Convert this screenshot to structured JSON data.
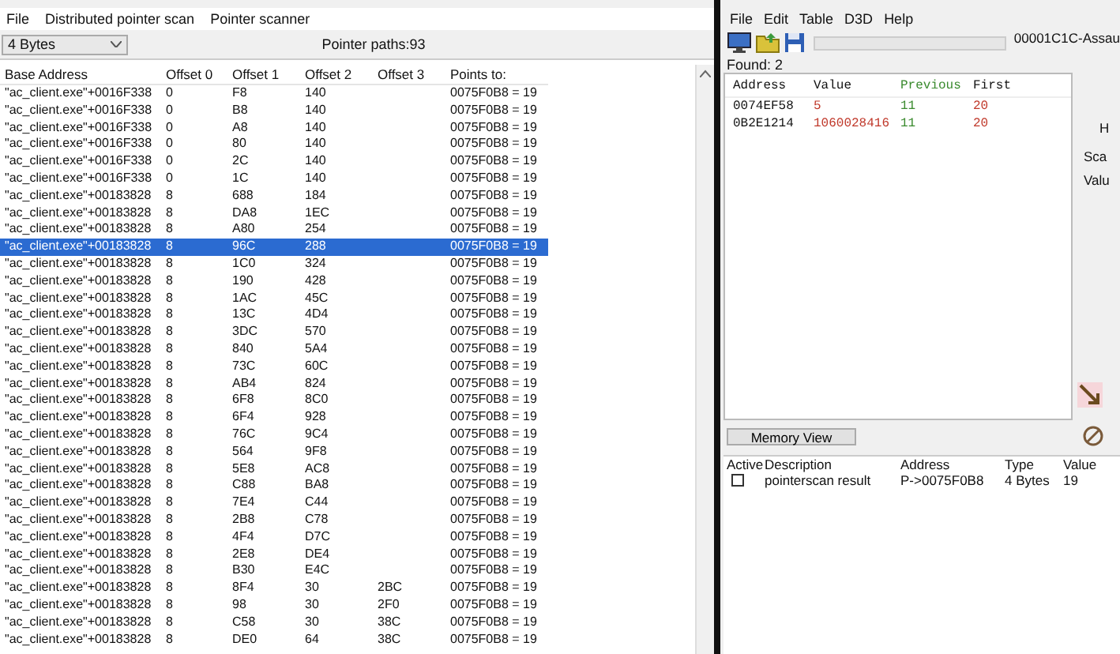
{
  "pointer_scanner": {
    "menu": [
      "File",
      "Distributed pointer scan",
      "Pointer scanner"
    ],
    "type_select": {
      "value": "4 Bytes"
    },
    "pointer_paths": "Pointer paths:93",
    "table": {
      "columns": [
        "Base Address",
        "Offset 0",
        "Offset 1",
        "Offset 2",
        "Offset 3",
        "Points to:"
      ],
      "rows": [
        {
          "cells": [
            "\"ac_client.exe\"+0016F338",
            "0",
            "F8",
            "140",
            "",
            "0075F0B8 = 19"
          ],
          "selected": false
        },
        {
          "cells": [
            "\"ac_client.exe\"+0016F338",
            "0",
            "B8",
            "140",
            "",
            "0075F0B8 = 19"
          ],
          "selected": false
        },
        {
          "cells": [
            "\"ac_client.exe\"+0016F338",
            "0",
            "A8",
            "140",
            "",
            "0075F0B8 = 19"
          ],
          "selected": false
        },
        {
          "cells": [
            "\"ac_client.exe\"+0016F338",
            "0",
            "80",
            "140",
            "",
            "0075F0B8 = 19"
          ],
          "selected": false
        },
        {
          "cells": [
            "\"ac_client.exe\"+0016F338",
            "0",
            "2C",
            "140",
            "",
            "0075F0B8 = 19"
          ],
          "selected": false
        },
        {
          "cells": [
            "\"ac_client.exe\"+0016F338",
            "0",
            "1C",
            "140",
            "",
            "0075F0B8 = 19"
          ],
          "selected": false
        },
        {
          "cells": [
            "\"ac_client.exe\"+00183828",
            "8",
            "688",
            "184",
            "",
            "0075F0B8 = 19"
          ],
          "selected": false
        },
        {
          "cells": [
            "\"ac_client.exe\"+00183828",
            "8",
            "DA8",
            "1EC",
            "",
            "0075F0B8 = 19"
          ],
          "selected": false
        },
        {
          "cells": [
            "\"ac_client.exe\"+00183828",
            "8",
            "A80",
            "254",
            "",
            "0075F0B8 = 19"
          ],
          "selected": false
        },
        {
          "cells": [
            "\"ac_client.exe\"+00183828",
            "8",
            "96C",
            "288",
            "",
            "0075F0B8 = 19"
          ],
          "selected": true
        },
        {
          "cells": [
            "\"ac_client.exe\"+00183828",
            "8",
            "1C0",
            "324",
            "",
            "0075F0B8 = 19"
          ],
          "selected": false
        },
        {
          "cells": [
            "\"ac_client.exe\"+00183828",
            "8",
            "190",
            "428",
            "",
            "0075F0B8 = 19"
          ],
          "selected": false
        },
        {
          "cells": [
            "\"ac_client.exe\"+00183828",
            "8",
            "1AC",
            "45C",
            "",
            "0075F0B8 = 19"
          ],
          "selected": false
        },
        {
          "cells": [
            "\"ac_client.exe\"+00183828",
            "8",
            "13C",
            "4D4",
            "",
            "0075F0B8 = 19"
          ],
          "selected": false
        },
        {
          "cells": [
            "\"ac_client.exe\"+00183828",
            "8",
            "3DC",
            "570",
            "",
            "0075F0B8 = 19"
          ],
          "selected": false
        },
        {
          "cells": [
            "\"ac_client.exe\"+00183828",
            "8",
            "840",
            "5A4",
            "",
            "0075F0B8 = 19"
          ],
          "selected": false
        },
        {
          "cells": [
            "\"ac_client.exe\"+00183828",
            "8",
            "73C",
            "60C",
            "",
            "0075F0B8 = 19"
          ],
          "selected": false
        },
        {
          "cells": [
            "\"ac_client.exe\"+00183828",
            "8",
            "AB4",
            "824",
            "",
            "0075F0B8 = 19"
          ],
          "selected": false
        },
        {
          "cells": [
            "\"ac_client.exe\"+00183828",
            "8",
            "6F8",
            "8C0",
            "",
            "0075F0B8 = 19"
          ],
          "selected": false
        },
        {
          "cells": [
            "\"ac_client.exe\"+00183828",
            "8",
            "6F4",
            "928",
            "",
            "0075F0B8 = 19"
          ],
          "selected": false
        },
        {
          "cells": [
            "\"ac_client.exe\"+00183828",
            "8",
            "76C",
            "9C4",
            "",
            "0075F0B8 = 19"
          ],
          "selected": false
        },
        {
          "cells": [
            "\"ac_client.exe\"+00183828",
            "8",
            "564",
            "9F8",
            "",
            "0075F0B8 = 19"
          ],
          "selected": false
        },
        {
          "cells": [
            "\"ac_client.exe\"+00183828",
            "8",
            "5E8",
            "AC8",
            "",
            "0075F0B8 = 19"
          ],
          "selected": false
        },
        {
          "cells": [
            "\"ac_client.exe\"+00183828",
            "8",
            "C88",
            "BA8",
            "",
            "0075F0B8 = 19"
          ],
          "selected": false
        },
        {
          "cells": [
            "\"ac_client.exe\"+00183828",
            "8",
            "7E4",
            "C44",
            "",
            "0075F0B8 = 19"
          ],
          "selected": false
        },
        {
          "cells": [
            "\"ac_client.exe\"+00183828",
            "8",
            "2B8",
            "C78",
            "",
            "0075F0B8 = 19"
          ],
          "selected": false
        },
        {
          "cells": [
            "\"ac_client.exe\"+00183828",
            "8",
            "4F4",
            "D7C",
            "",
            "0075F0B8 = 19"
          ],
          "selected": false
        },
        {
          "cells": [
            "\"ac_client.exe\"+00183828",
            "8",
            "2E8",
            "DE4",
            "",
            "0075F0B8 = 19"
          ],
          "selected": false
        },
        {
          "cells": [
            "\"ac_client.exe\"+00183828",
            "8",
            "B30",
            "E4C",
            "",
            "0075F0B8 = 19"
          ],
          "selected": false
        },
        {
          "cells": [
            "\"ac_client.exe\"+00183828",
            "8",
            "8F4",
            "30",
            "2BC",
            "0075F0B8 = 19"
          ],
          "selected": false
        },
        {
          "cells": [
            "\"ac_client.exe\"+00183828",
            "8",
            "98",
            "30",
            "2F0",
            "0075F0B8 = 19"
          ],
          "selected": false
        },
        {
          "cells": [
            "\"ac_client.exe\"+00183828",
            "8",
            "C58",
            "30",
            "38C",
            "0075F0B8 = 19"
          ],
          "selected": false
        },
        {
          "cells": [
            "\"ac_client.exe\"+00183828",
            "8",
            "DE0",
            "64",
            "38C",
            "0075F0B8 = 19"
          ],
          "selected": false
        }
      ]
    }
  },
  "cheat_engine": {
    "menu": [
      "File",
      "Edit",
      "Table",
      "D3D",
      "Help"
    ],
    "process_title": "00001C1C-Assau",
    "scan_progress": {
      "level": 0
    },
    "found": "Found: 2",
    "results": {
      "columns": [
        "Address",
        "Value",
        "Previous",
        "First"
      ],
      "rows": [
        [
          "0074EF58",
          "5",
          "11",
          "20"
        ],
        [
          "0B2E1214",
          "1060028416",
          "11",
          "20"
        ]
      ]
    },
    "side_labels": [
      "H",
      "Sca",
      "Valu"
    ],
    "memory_view_button": "Memory View",
    "address_list": {
      "columns": [
        "Active",
        "Description",
        "Address",
        "Type",
        "Value"
      ],
      "rows": [
        {
          "active": false,
          "description": "pointerscan result",
          "address": "P->0075F0B8",
          "type": "4 Bytes",
          "value": "19"
        }
      ]
    }
  }
}
